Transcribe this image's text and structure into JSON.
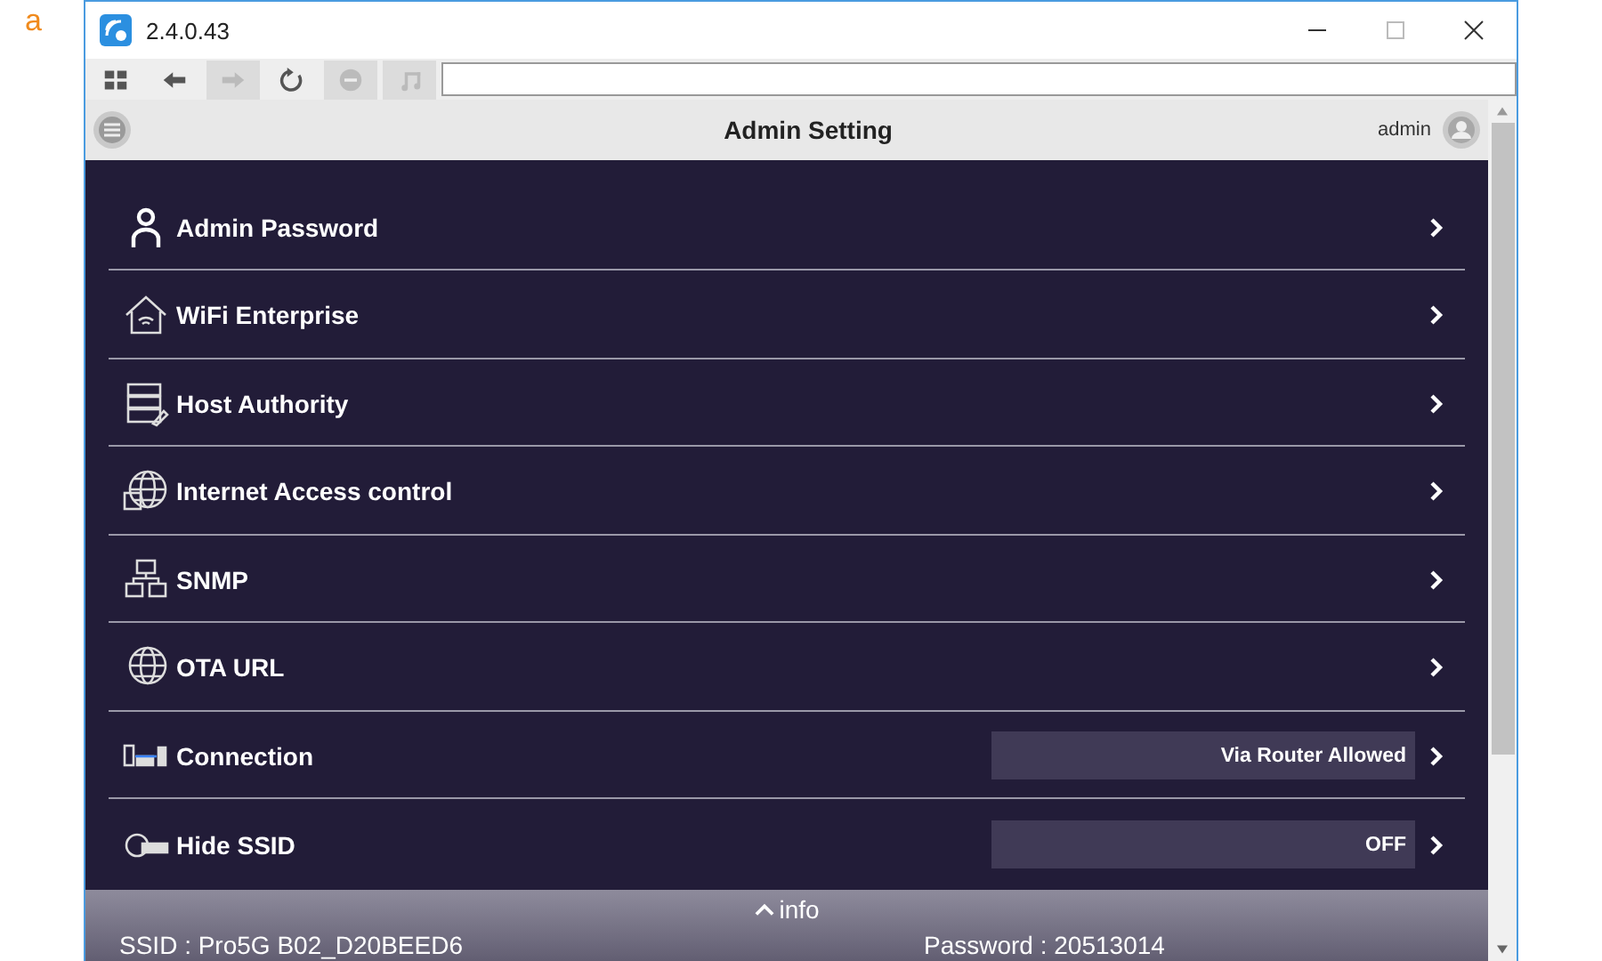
{
  "figure_label": "a",
  "window": {
    "title": "2.4.0.43"
  },
  "toolbar": [
    {
      "kind": "grid",
      "disabled": false
    },
    {
      "kind": "back",
      "disabled": false
    },
    {
      "kind": "forward",
      "disabled": true
    },
    {
      "kind": "reload",
      "disabled": false
    },
    {
      "kind": "stop",
      "disabled": true
    },
    {
      "kind": "music",
      "disabled": true
    }
  ],
  "header": {
    "title": "Admin Setting",
    "user": "admin"
  },
  "menu": [
    {
      "kind": "user",
      "label": "Admin Password"
    },
    {
      "kind": "house",
      "label": "WiFi Enterprise"
    },
    {
      "kind": "server",
      "label": "Host Authority"
    },
    {
      "kind": "globe",
      "label": "Internet Access control"
    },
    {
      "kind": "network",
      "label": "SNMP"
    },
    {
      "kind": "web",
      "label": "OTA URL"
    },
    {
      "kind": "connection",
      "label": "Connection",
      "value": "Via Router Allowed"
    },
    {
      "kind": "key",
      "label": "Hide SSID",
      "value": "OFF"
    }
  ],
  "info": {
    "toggle": "info",
    "ssid": "SSID : Pro5G B02_D20BEED6",
    "password": "Password : 20513014"
  }
}
